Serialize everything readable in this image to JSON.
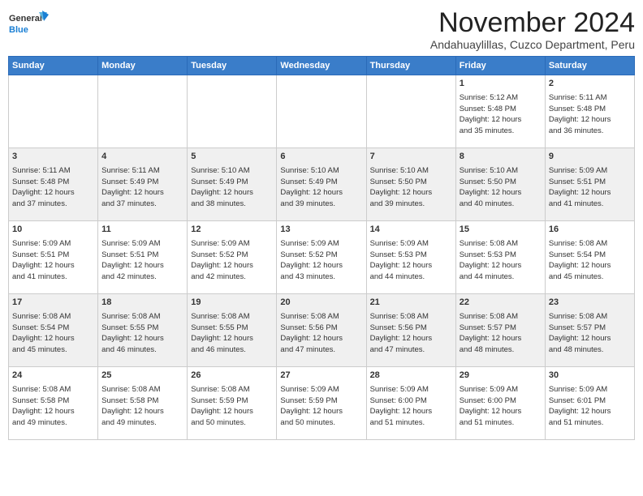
{
  "logo": {
    "line1": "General",
    "line2": "Blue"
  },
  "title": "November 2024",
  "subtitle": "Andahuaylillas, Cuzco Department, Peru",
  "weekdays": [
    "Sunday",
    "Monday",
    "Tuesday",
    "Wednesday",
    "Thursday",
    "Friday",
    "Saturday"
  ],
  "weeks": [
    [
      {
        "day": "",
        "info": ""
      },
      {
        "day": "",
        "info": ""
      },
      {
        "day": "",
        "info": ""
      },
      {
        "day": "",
        "info": ""
      },
      {
        "day": "",
        "info": ""
      },
      {
        "day": "1",
        "info": "Sunrise: 5:12 AM\nSunset: 5:48 PM\nDaylight: 12 hours\nand 35 minutes."
      },
      {
        "day": "2",
        "info": "Sunrise: 5:11 AM\nSunset: 5:48 PM\nDaylight: 12 hours\nand 36 minutes."
      }
    ],
    [
      {
        "day": "3",
        "info": "Sunrise: 5:11 AM\nSunset: 5:48 PM\nDaylight: 12 hours\nand 37 minutes."
      },
      {
        "day": "4",
        "info": "Sunrise: 5:11 AM\nSunset: 5:49 PM\nDaylight: 12 hours\nand 37 minutes."
      },
      {
        "day": "5",
        "info": "Sunrise: 5:10 AM\nSunset: 5:49 PM\nDaylight: 12 hours\nand 38 minutes."
      },
      {
        "day": "6",
        "info": "Sunrise: 5:10 AM\nSunset: 5:49 PM\nDaylight: 12 hours\nand 39 minutes."
      },
      {
        "day": "7",
        "info": "Sunrise: 5:10 AM\nSunset: 5:50 PM\nDaylight: 12 hours\nand 39 minutes."
      },
      {
        "day": "8",
        "info": "Sunrise: 5:10 AM\nSunset: 5:50 PM\nDaylight: 12 hours\nand 40 minutes."
      },
      {
        "day": "9",
        "info": "Sunrise: 5:09 AM\nSunset: 5:51 PM\nDaylight: 12 hours\nand 41 minutes."
      }
    ],
    [
      {
        "day": "10",
        "info": "Sunrise: 5:09 AM\nSunset: 5:51 PM\nDaylight: 12 hours\nand 41 minutes."
      },
      {
        "day": "11",
        "info": "Sunrise: 5:09 AM\nSunset: 5:51 PM\nDaylight: 12 hours\nand 42 minutes."
      },
      {
        "day": "12",
        "info": "Sunrise: 5:09 AM\nSunset: 5:52 PM\nDaylight: 12 hours\nand 42 minutes."
      },
      {
        "day": "13",
        "info": "Sunrise: 5:09 AM\nSunset: 5:52 PM\nDaylight: 12 hours\nand 43 minutes."
      },
      {
        "day": "14",
        "info": "Sunrise: 5:09 AM\nSunset: 5:53 PM\nDaylight: 12 hours\nand 44 minutes."
      },
      {
        "day": "15",
        "info": "Sunrise: 5:08 AM\nSunset: 5:53 PM\nDaylight: 12 hours\nand 44 minutes."
      },
      {
        "day": "16",
        "info": "Sunrise: 5:08 AM\nSunset: 5:54 PM\nDaylight: 12 hours\nand 45 minutes."
      }
    ],
    [
      {
        "day": "17",
        "info": "Sunrise: 5:08 AM\nSunset: 5:54 PM\nDaylight: 12 hours\nand 45 minutes."
      },
      {
        "day": "18",
        "info": "Sunrise: 5:08 AM\nSunset: 5:55 PM\nDaylight: 12 hours\nand 46 minutes."
      },
      {
        "day": "19",
        "info": "Sunrise: 5:08 AM\nSunset: 5:55 PM\nDaylight: 12 hours\nand 46 minutes."
      },
      {
        "day": "20",
        "info": "Sunrise: 5:08 AM\nSunset: 5:56 PM\nDaylight: 12 hours\nand 47 minutes."
      },
      {
        "day": "21",
        "info": "Sunrise: 5:08 AM\nSunset: 5:56 PM\nDaylight: 12 hours\nand 47 minutes."
      },
      {
        "day": "22",
        "info": "Sunrise: 5:08 AM\nSunset: 5:57 PM\nDaylight: 12 hours\nand 48 minutes."
      },
      {
        "day": "23",
        "info": "Sunrise: 5:08 AM\nSunset: 5:57 PM\nDaylight: 12 hours\nand 48 minutes."
      }
    ],
    [
      {
        "day": "24",
        "info": "Sunrise: 5:08 AM\nSunset: 5:58 PM\nDaylight: 12 hours\nand 49 minutes."
      },
      {
        "day": "25",
        "info": "Sunrise: 5:08 AM\nSunset: 5:58 PM\nDaylight: 12 hours\nand 49 minutes."
      },
      {
        "day": "26",
        "info": "Sunrise: 5:08 AM\nSunset: 5:59 PM\nDaylight: 12 hours\nand 50 minutes."
      },
      {
        "day": "27",
        "info": "Sunrise: 5:09 AM\nSunset: 5:59 PM\nDaylight: 12 hours\nand 50 minutes."
      },
      {
        "day": "28",
        "info": "Sunrise: 5:09 AM\nSunset: 6:00 PM\nDaylight: 12 hours\nand 51 minutes."
      },
      {
        "day": "29",
        "info": "Sunrise: 5:09 AM\nSunset: 6:00 PM\nDaylight: 12 hours\nand 51 minutes."
      },
      {
        "day": "30",
        "info": "Sunrise: 5:09 AM\nSunset: 6:01 PM\nDaylight: 12 hours\nand 51 minutes."
      }
    ]
  ]
}
